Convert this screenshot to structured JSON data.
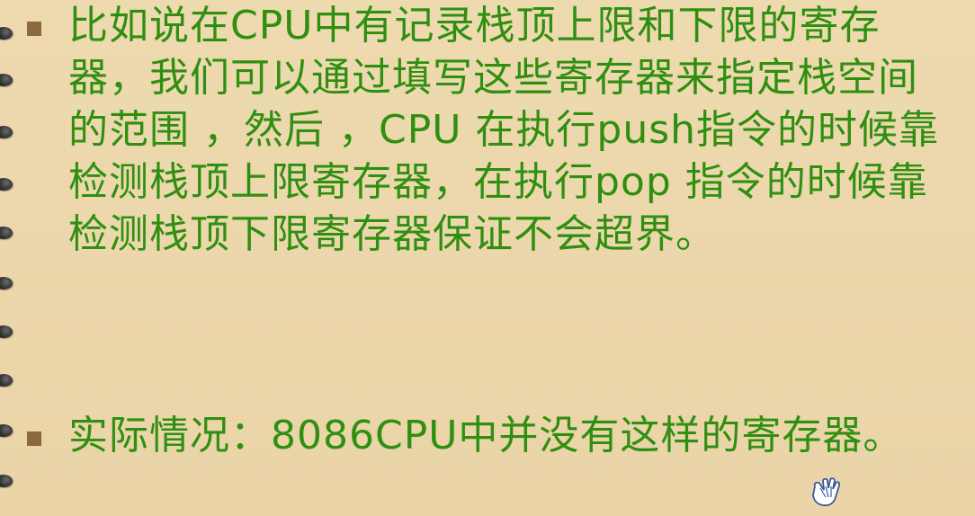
{
  "slide": {
    "bullets": [
      {
        "text": "比如说在CPU中有记录栈顶上限和下限的寄存器，我们可以通过填写这些寄存器来指定栈空间的范围 ，然后 ，CPU 在执行push指令的时候靠检测栈顶上限寄存器，在执行pop 指令的时候靠检测栈顶下限寄存器保证不会超界。"
      },
      {
        "text": "实际情况：8086CPU中并没有这样的寄存器。"
      }
    ]
  },
  "colors": {
    "background": "#ecd7ad",
    "text": "#2f8f10",
    "bullet": "#8a6a3a",
    "spiral_ring": "#2a2a2a"
  },
  "icons": {
    "cursor": "hand-pointer-icon",
    "binding": "spiral-binding-icon"
  }
}
